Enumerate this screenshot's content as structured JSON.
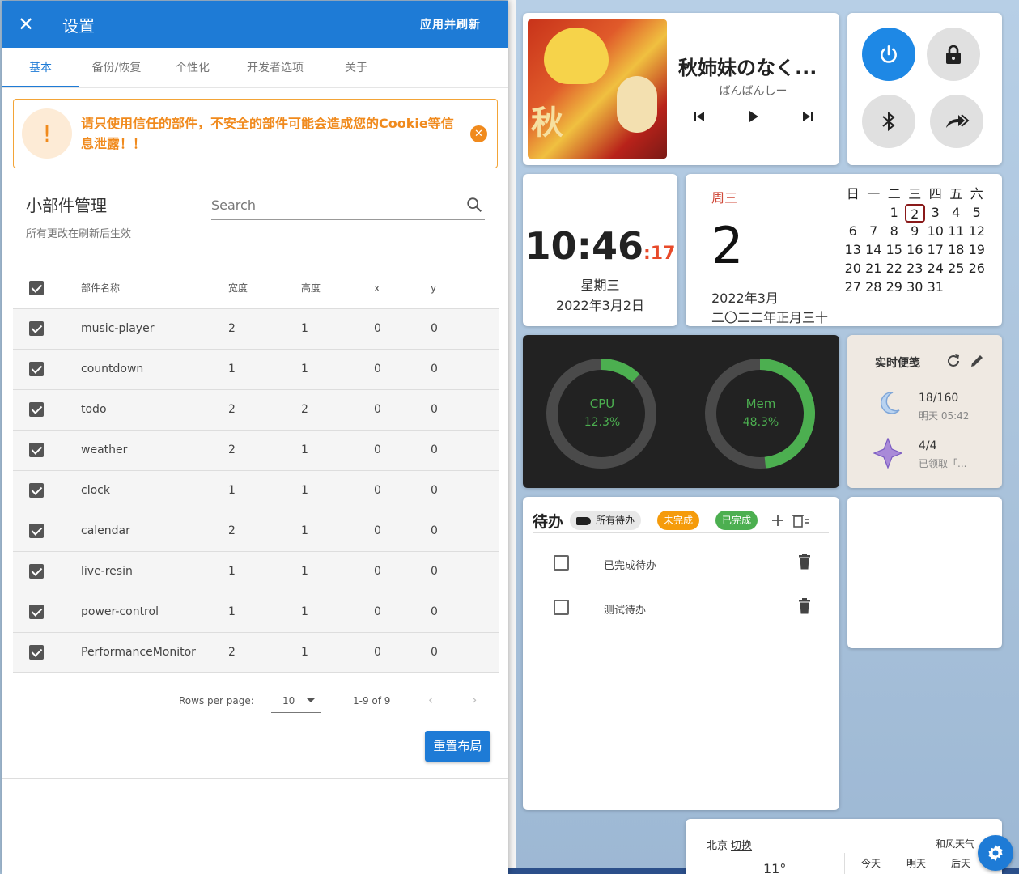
{
  "settings": {
    "title": "设置",
    "apply_label": "应用并刷新",
    "tabs": [
      "基本",
      "备份/恢复",
      "个性化",
      "开发者选项",
      "关于"
    ],
    "warning": "请只使用信任的部件，不安全的部件可能会造成您的Cookie等信息泄露！！",
    "warning_icon": "!",
    "manager_title": "小部件管理",
    "manager_subtitle": "所有更改在刷新后生效",
    "search_placeholder": "Search",
    "columns": [
      "部件名称",
      "宽度",
      "高度",
      "x",
      "y"
    ],
    "rows": [
      {
        "name": "music-player",
        "w": "2",
        "h": "1",
        "x": "0",
        "y": "0"
      },
      {
        "name": "countdown",
        "w": "1",
        "h": "1",
        "x": "0",
        "y": "0"
      },
      {
        "name": "todo",
        "w": "2",
        "h": "2",
        "x": "0",
        "y": "0"
      },
      {
        "name": "weather",
        "w": "2",
        "h": "1",
        "x": "0",
        "y": "0"
      },
      {
        "name": "clock",
        "w": "1",
        "h": "1",
        "x": "0",
        "y": "0"
      },
      {
        "name": "calendar",
        "w": "2",
        "h": "1",
        "x": "0",
        "y": "0"
      },
      {
        "name": "live-resin",
        "w": "1",
        "h": "1",
        "x": "0",
        "y": "0"
      },
      {
        "name": "power-control",
        "w": "1",
        "h": "1",
        "x": "0",
        "y": "0"
      },
      {
        "name": "PerformanceMonitor",
        "w": "2",
        "h": "1",
        "x": "0",
        "y": "0"
      }
    ],
    "pager": {
      "rows_per_page_label": "Rows per page:",
      "rows_per_page": "10",
      "range": "1-9 of 9"
    },
    "reset_label": "重置布局"
  },
  "music": {
    "song": "秋姉妹のなく...",
    "artist": "ばんばんしー",
    "art_text": "秋"
  },
  "clock": {
    "hm": "10:46",
    "sec": ":17",
    "weekday": "星期三",
    "date": "2022年3月2日"
  },
  "calendar": {
    "weekday": "周三",
    "day": "2",
    "year_month": "2022年3月",
    "lunar": "二〇二二年正月三十",
    "week_header": [
      "日",
      "一",
      "二",
      "三",
      "四",
      "五",
      "六"
    ],
    "weeks": [
      [
        "",
        "",
        "",
        "1",
        "2",
        "3",
        "4",
        "5"
      ],
      [
        "6",
        "7",
        "8",
        "9",
        "10",
        "11",
        "12"
      ],
      [
        "13",
        "14",
        "15",
        "16",
        "17",
        "18",
        "19"
      ],
      [
        "20",
        "21",
        "22",
        "23",
        "24",
        "25",
        "26"
      ],
      [
        "27",
        "28",
        "29",
        "30",
        "31",
        "",
        ""
      ]
    ],
    "today": "2"
  },
  "perf": {
    "cpu_label": "CPU",
    "cpu_value": "12.3%",
    "cpu_fraction": 0.123,
    "mem_label": "Mem",
    "mem_value": "48.3%",
    "mem_fraction": 0.483
  },
  "resin": {
    "title": "实时便笺",
    "resin_value": "18/160",
    "resin_time": "明天 05:42",
    "task_value": "4/4",
    "task_status": "已领取「..."
  },
  "todo": {
    "title": "待办",
    "chips": {
      "all": "所有待办",
      "undone": "未完成",
      "done": "已完成"
    },
    "items": [
      "已完成待办",
      "测试待办"
    ]
  },
  "weather": {
    "city": "北京",
    "switch": "切换",
    "source": "和风天气",
    "temp": "11°",
    "days": [
      "今天",
      "明天",
      "后天"
    ]
  },
  "colors": {
    "primary": "#1e7bd6",
    "warning": "#f08a1d",
    "cpu_ring": "#4caf50",
    "undone_chip": "#f59b0b",
    "done_chip": "#4caf50"
  }
}
